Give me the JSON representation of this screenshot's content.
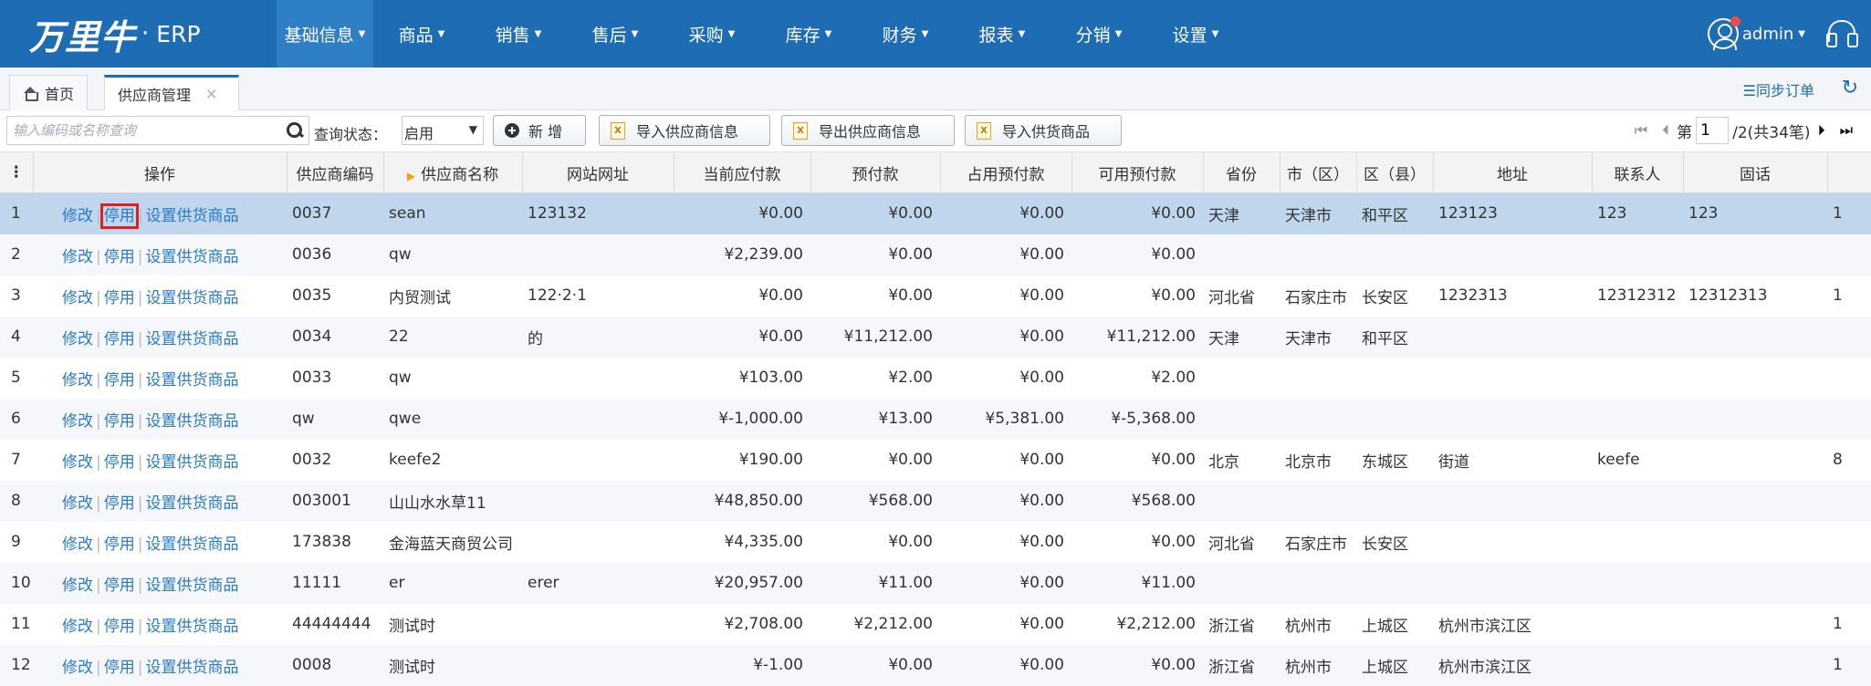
{
  "header": {
    "logo_text": "万里牛",
    "logo_dot": "·",
    "logo_suffix": "ERP",
    "menu": [
      {
        "label": "基础信息"
      },
      {
        "label": "商品"
      },
      {
        "label": "销售"
      },
      {
        "label": "售后"
      },
      {
        "label": "采购"
      },
      {
        "label": "库存"
      },
      {
        "label": "财务"
      },
      {
        "label": "报表"
      },
      {
        "label": "分销"
      },
      {
        "label": "设置"
      }
    ],
    "user": "admin"
  },
  "tabs": {
    "home": "首页",
    "current": "供应商管理",
    "close": "×",
    "sync": "☰同步订单"
  },
  "toolbar": {
    "search_placeholder": "输入编码或名称查询",
    "status_label": "查询状态：",
    "status_value": "启用",
    "add_label": "新 增",
    "import_supplier": "导入供应商信息",
    "export_supplier": "导出供应商信息",
    "import_goods": "导入供货商品"
  },
  "pager": {
    "page_prefix": "第",
    "page": "1",
    "page_suffix": "/2(共34笔)"
  },
  "table": {
    "columns": [
      "操作",
      "供应商编码",
      "供应商名称",
      "网站网址",
      "当前应付款",
      "预付款",
      "占用预付款",
      "可用预付款",
      "省份",
      "市（区）",
      "区（县）",
      "地址",
      "联系人",
      "固话"
    ],
    "op_edit": "修改",
    "op_disable": "停用",
    "op_goods": "设置供货商品",
    "rows": [
      {
        "no": "1",
        "code": "0037",
        "name": "sean",
        "site": "123132",
        "payable": "¥0.00",
        "prepay": "¥0.00",
        "used": "¥0.00",
        "avail": "¥0.00",
        "prov": "天津",
        "city": "天津市",
        "dist": "和平区",
        "addr": "123123",
        "contact": "123",
        "phone": "123",
        "extra": "1"
      },
      {
        "no": "2",
        "code": "0036",
        "name": "qw",
        "site": "",
        "payable": "¥2,239.00",
        "prepay": "¥0.00",
        "used": "¥0.00",
        "avail": "¥0.00",
        "prov": "",
        "city": "",
        "dist": "",
        "addr": "",
        "contact": "",
        "phone": "",
        "extra": ""
      },
      {
        "no": "3",
        "code": "0035",
        "name": "内贸测试",
        "site": "122·2·1",
        "payable": "¥0.00",
        "prepay": "¥0.00",
        "used": "¥0.00",
        "avail": "¥0.00",
        "prov": "河北省",
        "city": "石家庄市",
        "dist": "长安区",
        "addr": "1232313",
        "contact": "12312312",
        "phone": "12312313",
        "extra": "1"
      },
      {
        "no": "4",
        "code": "0034",
        "name": "22",
        "site": "的",
        "payable": "¥0.00",
        "prepay": "¥11,212.00",
        "used": "¥0.00",
        "avail": "¥11,212.00",
        "prov": "天津",
        "city": "天津市",
        "dist": "和平区",
        "addr": "",
        "contact": "",
        "phone": "",
        "extra": ""
      },
      {
        "no": "5",
        "code": "0033",
        "name": "qw",
        "site": "",
        "payable": "¥103.00",
        "prepay": "¥2.00",
        "used": "¥0.00",
        "avail": "¥2.00",
        "prov": "",
        "city": "",
        "dist": "",
        "addr": "",
        "contact": "",
        "phone": "",
        "extra": ""
      },
      {
        "no": "6",
        "code": "qw",
        "name": "qwe",
        "site": "",
        "payable": "¥-1,000.00",
        "prepay": "¥13.00",
        "used": "¥5,381.00",
        "avail": "¥-5,368.00",
        "prov": "",
        "city": "",
        "dist": "",
        "addr": "",
        "contact": "",
        "phone": "",
        "extra": ""
      },
      {
        "no": "7",
        "code": "0032",
        "name": "keefe2",
        "site": "",
        "payable": "¥190.00",
        "prepay": "¥0.00",
        "used": "¥0.00",
        "avail": "¥0.00",
        "prov": "北京",
        "city": "北京市",
        "dist": "东城区",
        "addr": "街道",
        "contact": "keefe",
        "phone": "",
        "extra": "8"
      },
      {
        "no": "8",
        "code": "003001",
        "name": "山山水水草11",
        "site": "",
        "payable": "¥48,850.00",
        "prepay": "¥568.00",
        "used": "¥0.00",
        "avail": "¥568.00",
        "prov": "",
        "city": "",
        "dist": "",
        "addr": "",
        "contact": "",
        "phone": "",
        "extra": ""
      },
      {
        "no": "9",
        "code": "173838",
        "name": "金海蓝天商贸公司",
        "site": "",
        "payable": "¥4,335.00",
        "prepay": "¥0.00",
        "used": "¥0.00",
        "avail": "¥0.00",
        "prov": "河北省",
        "city": "石家庄市",
        "dist": "长安区",
        "addr": "",
        "contact": "",
        "phone": "",
        "extra": ""
      },
      {
        "no": "10",
        "code": "11111",
        "name": "er",
        "site": "erer",
        "payable": "¥20,957.00",
        "prepay": "¥11.00",
        "used": "¥0.00",
        "avail": "¥11.00",
        "prov": "",
        "city": "",
        "dist": "",
        "addr": "",
        "contact": "",
        "phone": "",
        "extra": ""
      },
      {
        "no": "11",
        "code": "44444444",
        "name": "测试时",
        "site": "",
        "payable": "¥2,708.00",
        "prepay": "¥2,212.00",
        "used": "¥0.00",
        "avail": "¥2,212.00",
        "prov": "浙江省",
        "city": "杭州市",
        "dist": "上城区",
        "addr": "杭州市滨江区",
        "contact": "",
        "phone": "",
        "extra": "1"
      },
      {
        "no": "12",
        "code": "0008",
        "name": "测试时",
        "site": "",
        "payable": "¥-1.00",
        "prepay": "¥0.00",
        "used": "¥0.00",
        "avail": "¥0.00",
        "prov": "浙江省",
        "city": "杭州市",
        "dist": "上城区",
        "addr": "杭州市滨江区",
        "contact": "",
        "phone": "",
        "extra": "1"
      }
    ]
  }
}
